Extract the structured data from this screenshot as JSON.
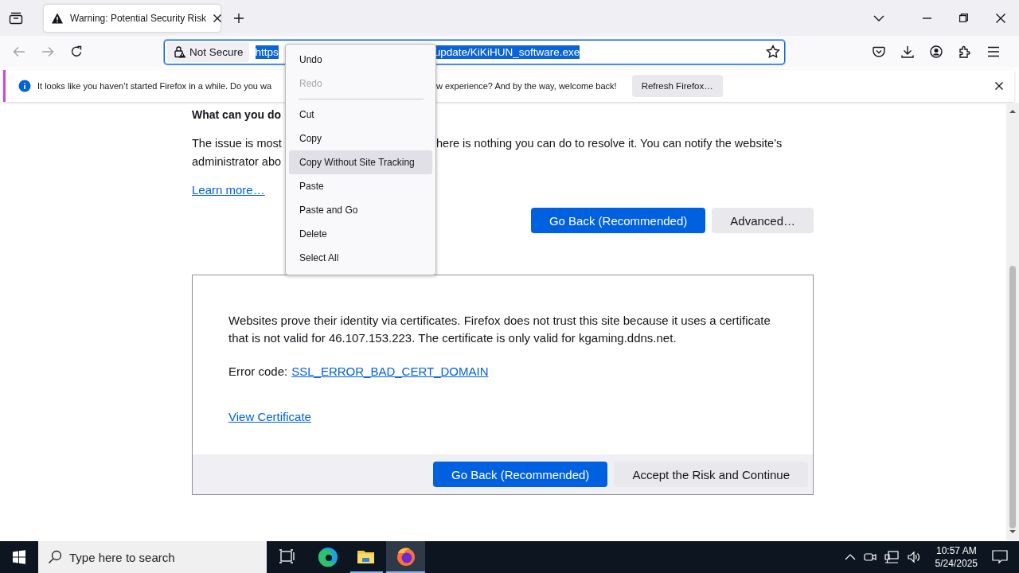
{
  "tab_strip": {
    "tabs": [
      {
        "title": "Warning: Potential Security Risk",
        "selected": true
      }
    ]
  },
  "address_bar": {
    "security_label": "Not Secure",
    "url_parts": [
      "https",
      "update/KiKiHUN_software.exe"
    ],
    "selected": true
  },
  "notification": {
    "text_parts": [
      "It looks like you haven’t started Firefox in a while. Do you wa",
      "w experience? And by the way, welcome back!"
    ],
    "button": "Refresh Firefox…"
  },
  "page": {
    "heading": "What can you do",
    "paragraph_lines": [
      [
        "The issue is most",
        "here is nothing you can do to resolve it. You can notify the website’s"
      ],
      [
        "administrator abo"
      ]
    ],
    "learn_more": "Learn more…",
    "buttons": [
      {
        "label": "Go Back (Recommended)",
        "kind": "primary"
      },
      {
        "label": "Advanced…",
        "kind": "secondary"
      }
    ],
    "advanced_panel": {
      "paragraph": "Websites prove their identity via certificates. Firefox does not trust this site because it uses a certificate that is not valid for 46.107.153.223. The certificate is only valid for kgaming.ddns.net.",
      "error_label": "Error code:",
      "error_code": "SSL_ERROR_BAD_CERT_DOMAIN",
      "view_certificate": "View Certificate",
      "buttons": [
        {
          "label": "Go Back (Recommended)",
          "kind": "primary"
        },
        {
          "label": "Accept the Risk and Continue",
          "kind": "secondary"
        }
      ]
    }
  },
  "context_menu": {
    "items": [
      {
        "kind": "item",
        "label": "Undo",
        "disabled": false,
        "selected": false
      },
      {
        "kind": "item",
        "label": "Redo",
        "disabled": true,
        "selected": false
      },
      {
        "kind": "separator"
      },
      {
        "kind": "item",
        "label": "Cut",
        "disabled": false,
        "selected": false
      },
      {
        "kind": "item",
        "label": "Copy",
        "disabled": false,
        "selected": false
      },
      {
        "kind": "item",
        "label": "Copy Without Site Tracking",
        "disabled": false,
        "selected": true
      },
      {
        "kind": "item",
        "label": "Paste",
        "disabled": false,
        "selected": false
      },
      {
        "kind": "item",
        "label": "Paste and Go",
        "disabled": false,
        "selected": false
      },
      {
        "kind": "item",
        "label": "Delete",
        "disabled": false,
        "selected": false
      },
      {
        "kind": "item",
        "label": "Select All",
        "disabled": false,
        "selected": false
      }
    ]
  },
  "taskbar": {
    "search_placeholder": "Type here to search",
    "apps": [
      {
        "kind": "task-view",
        "selected": false
      },
      {
        "kind": "edge",
        "selected": false
      },
      {
        "kind": "explorer",
        "selected": false
      },
      {
        "kind": "firefox",
        "selected": true
      }
    ],
    "time": "10:57 AM",
    "date": "5/24/2025"
  }
}
